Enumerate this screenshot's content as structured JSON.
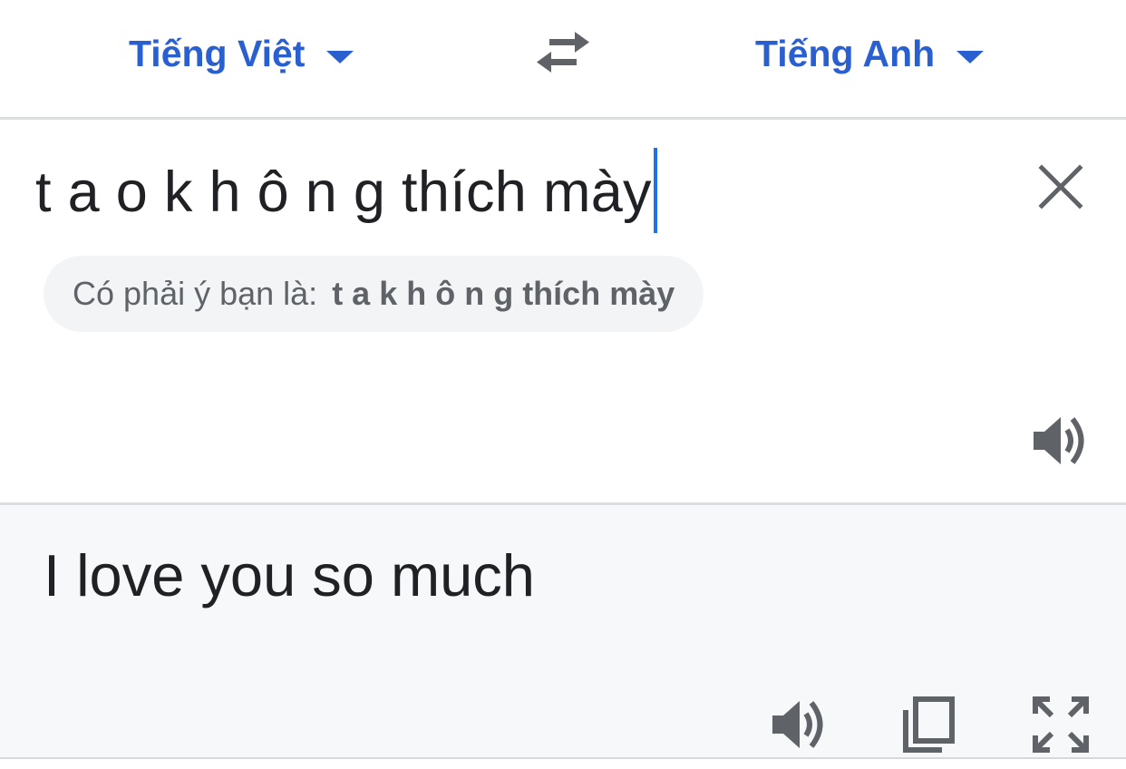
{
  "lang_bar": {
    "source_lang": "Tiếng Việt",
    "target_lang": "Tiếng Anh",
    "source_icon": "dropdown-caret",
    "swap_icon": "swap-arrows-icon",
    "target_icon": "dropdown-caret"
  },
  "source": {
    "text": "t a o k h ô n g thích mày",
    "clear_icon": "close-icon",
    "speak_icon": "speaker-icon"
  },
  "suggestion": {
    "prefix": "Có phải ý bạn là:",
    "fix": "t a k h ô n g thích mày"
  },
  "result": {
    "text": "I love you so much",
    "actions": [
      "speaker-icon",
      "copy-icon",
      "fullscreen-icon"
    ]
  },
  "colors": {
    "accent": "#2a5fcf",
    "cursor": "#1a73e8",
    "text": "#202124",
    "muted": "#5f6368",
    "icon": "#5f6368",
    "result_bg": "#f7f8fa",
    "divider": "#dcdde0"
  }
}
